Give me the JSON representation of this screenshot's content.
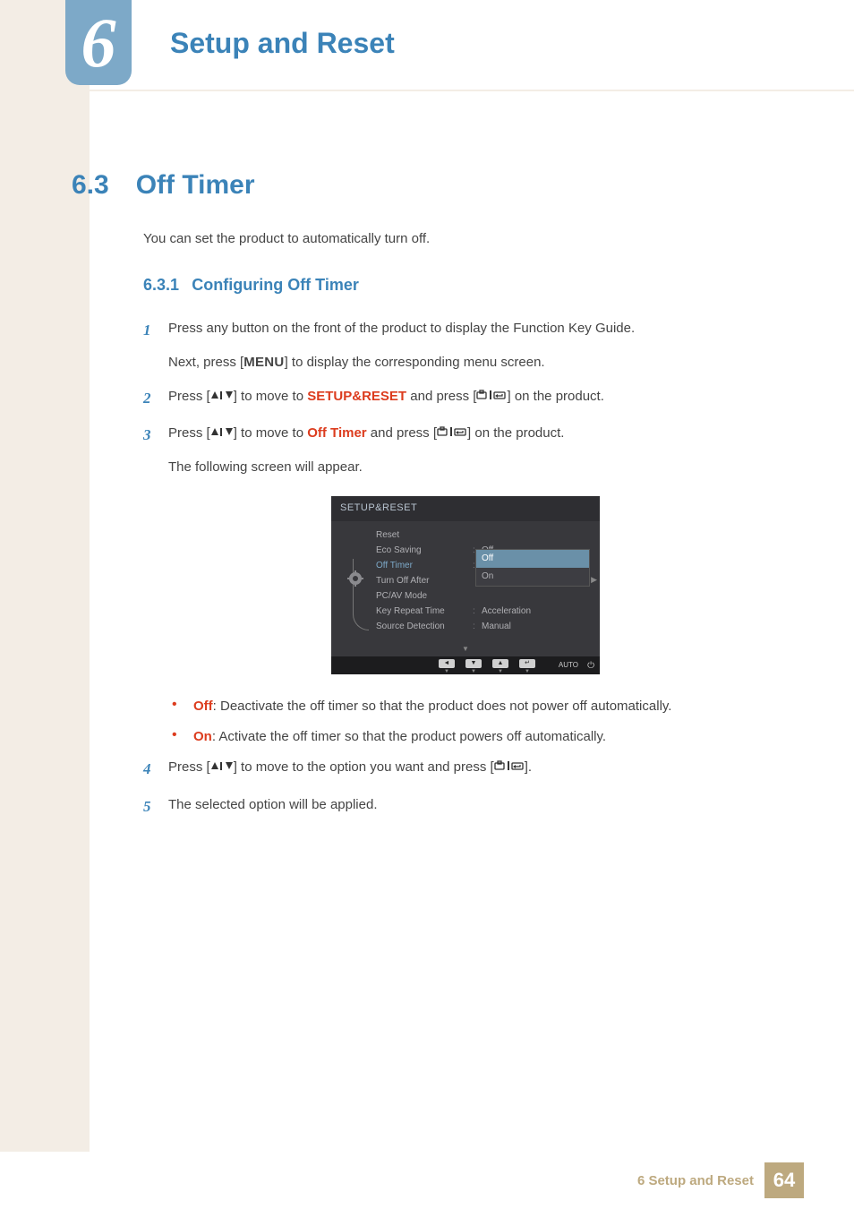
{
  "chapter": {
    "number": "6",
    "title": "Setup and Reset"
  },
  "section": {
    "number": "6.3",
    "title": "Off Timer",
    "intro": "You can set the product to automatically turn off."
  },
  "subsection": {
    "number": "6.3.1",
    "title": "Configuring Off Timer"
  },
  "steps": {
    "s1": {
      "num": "1",
      "line1": "Press any button on the front of the product to display the Function Key Guide.",
      "line2a": "Next, press [",
      "menu": "MENU",
      "line2b": "] to display the corresponding menu screen."
    },
    "s2": {
      "num": "2",
      "pre": "Press [",
      "mid": "] to move to ",
      "target": "SETUP&RESET",
      "post1": " and press [",
      "post2": "] on the product."
    },
    "s3": {
      "num": "3",
      "pre": "Press [",
      "mid": "] to move to ",
      "target": "Off Timer",
      "post1": " and press [",
      "post2": "] on the product.",
      "followup": "The following screen will appear."
    },
    "s4": {
      "num": "4",
      "pre": "Press [",
      "mid": "] to move to the option you want and press [",
      "post": "]."
    },
    "s5": {
      "num": "5",
      "text": "The selected option will be applied."
    }
  },
  "osd": {
    "header": "SETUP&RESET",
    "rows": [
      {
        "label": "Reset",
        "value": ""
      },
      {
        "label": "Eco Saving",
        "value": "Off"
      },
      {
        "label": "Off Timer",
        "value": "",
        "active": true
      },
      {
        "label": "Turn Off After",
        "value": ""
      },
      {
        "label": "PC/AV Mode",
        "value": ""
      },
      {
        "label": "Key Repeat Time",
        "value": "Acceleration"
      },
      {
        "label": "Source Detection",
        "value": "Manual"
      }
    ],
    "dropdown": {
      "options": [
        "Off",
        "On"
      ],
      "selected": "Off"
    },
    "footer_auto": "AUTO"
  },
  "bullets": {
    "off": {
      "label": "Off",
      "text": ": Deactivate the off timer so that the product does not power off automatically."
    },
    "on": {
      "label": "On",
      "text": ": Activate the off timer so that the product powers off automatically."
    }
  },
  "footer": {
    "text": "6 Setup and Reset",
    "page": "64"
  }
}
